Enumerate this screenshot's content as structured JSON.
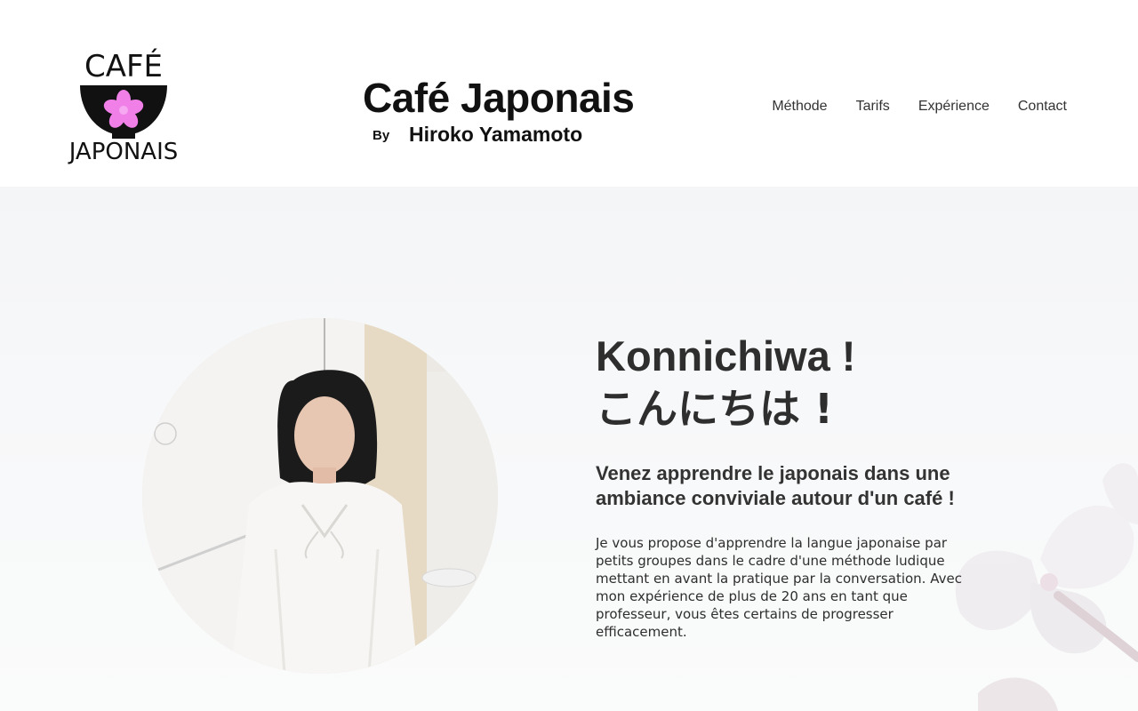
{
  "header": {
    "logo": {
      "top_text": "CAFÉ",
      "bottom_text": "JAPONAIS",
      "bowl_color": "#111111",
      "flower_color": "#f080e8"
    },
    "title": "Café Japonais",
    "by": "By",
    "author": "Hiroko Yamamoto"
  },
  "nav": {
    "items": [
      {
        "label": "Méthode"
      },
      {
        "label": "Tarifs"
      },
      {
        "label": "Expérience"
      },
      {
        "label": "Contact"
      }
    ]
  },
  "hero": {
    "greeting_latin": "Konnichiwa !",
    "greeting_japanese": "こんにちは !",
    "tagline": "Venez apprendre le japonais dans une ambiance conviviale autour d'un café !",
    "description": "Je vous propose d'apprendre la langue japonaise par petits groupes dans le cadre d'une méthode ludique mettant en avant la pratique par la conversation. Avec mon expérience de plus de 20 ans en tant que professeur, vous êtes certains de progresser efficacement."
  }
}
